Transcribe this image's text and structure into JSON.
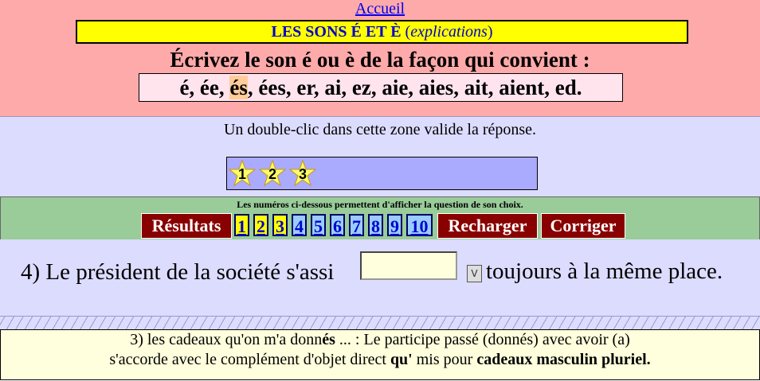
{
  "header": {
    "home_link": "Accueil",
    "title_main": "LES SONS É ET È",
    "title_paren_open": " (",
    "title_link": "explications",
    "title_paren_close": ")",
    "instruction": "Écrivez le son é ou è de la façon qui convient :",
    "spellings_before": "é, ée, ",
    "spellings_highlight": "és",
    "spellings_after": ", ées, er, ai, ez, aie, aies, ait, aient, ed."
  },
  "validation_zone": {
    "hint": "Un double-clic dans cette zone valide la réponse.",
    "stars": [
      "1",
      "2",
      "3"
    ],
    "star_color": "#ffff66"
  },
  "navigation": {
    "hint": "Les numéros ci-dessous permettent d'afficher la question de son choix.",
    "results_label": "Résultats",
    "numbers": [
      "1",
      "2",
      "3",
      "4",
      "5",
      "6",
      "7",
      "8",
      "9",
      "10"
    ],
    "reload_label": "Recharger",
    "correct_label": "Corriger",
    "dark_button_color": "#880000"
  },
  "question": {
    "prefix": "4) Le président de la société s'assi",
    "answer_value": "",
    "dropdown_glyph": "V",
    "suffix": "toujours à la même place."
  },
  "explanation": {
    "line1_a": "3) les cadeaux qu'on m'a donn",
    "line1_bold": "és",
    "line1_b": " ... : Le participe passé (donnés) avec avoir (a)",
    "line2_a": "s'accorde avec le complément d'objet direct ",
    "line2_bold1": "qu'",
    "line2_b": " mis pour ",
    "line2_bold2": "cadeaux masculin pluriel."
  }
}
